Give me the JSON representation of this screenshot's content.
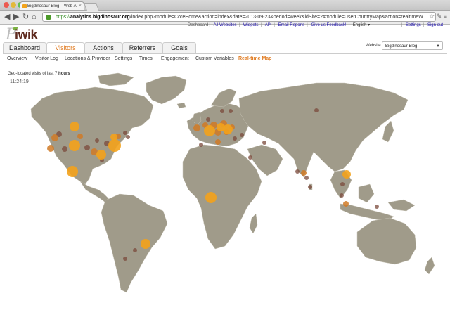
{
  "browser": {
    "tab_title": "Bigdinosaur Blog – Web A",
    "url_scheme": "https://",
    "url_host": "analytics.bigdinosaur.org",
    "url_path": "/index.php?module=CoreHome&action=index&date=2013-09-23&period=week&idSite=2#module=UserCountryMap&action=realtimeW..."
  },
  "header": {
    "logo_text": "iwik",
    "links": [
      "Dashboard",
      "All Websites",
      "Widgets",
      "API",
      "Email Reports",
      "Give us Feedback!",
      "English ▾",
      "Settings",
      "Sign out"
    ]
  },
  "main_tabs": [
    {
      "label": "Dashboard",
      "active": false
    },
    {
      "label": "Visitors",
      "active": true
    },
    {
      "label": "Actions",
      "active": false
    },
    {
      "label": "Referrers",
      "active": false
    },
    {
      "label": "Goals",
      "active": false
    }
  ],
  "website": {
    "label": "Website",
    "selected": "Bigdinosaur Blog"
  },
  "sub_nav": [
    "Overview",
    "Visitor Log",
    "Locations & Provider",
    "Settings",
    "Times",
    "Engagement",
    "Custom Variables",
    "Real-time Map"
  ],
  "map": {
    "caption_prefix": "Geo-located visits of last",
    "caption_value": "7 hours",
    "clock": "11:24:19"
  },
  "colors": {
    "accent": "#e07b21",
    "land": "#a09b8a",
    "visit_recent": "#f3a21b",
    "visit_mid": "#d07a26",
    "visit_old": "#7b4a3b"
  }
}
